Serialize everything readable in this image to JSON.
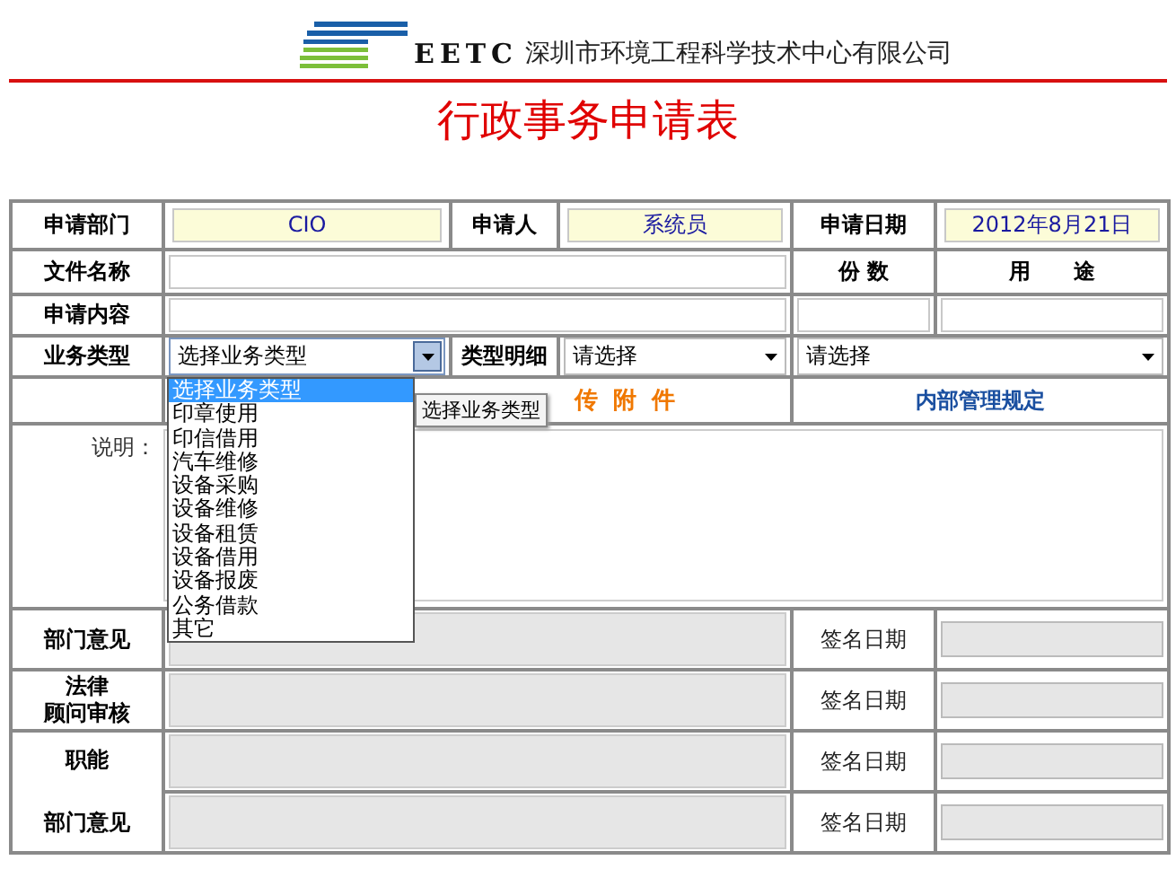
{
  "header": {
    "logo_text": "EETC",
    "company_name": "深圳市环境工程科学技术中心有限公司",
    "title": "行政事务申请表"
  },
  "form": {
    "department": {
      "label": "申请部门",
      "value": "CIO"
    },
    "applicant": {
      "label": "申请人",
      "value": "系统员"
    },
    "date": {
      "label": "申请日期",
      "value": "2012年8月21日"
    },
    "file_name": {
      "label": "文件名称"
    },
    "copies_label": "份 数",
    "purpose_label": "用　　途",
    "content": {
      "label": "申请内容"
    },
    "business_type": {
      "label": "业务类型",
      "value": "选择业务类型",
      "expanded": true,
      "tooltip": "选择业务类型",
      "options": [
        {
          "label": "选择业务类型",
          "selected": true
        },
        {
          "label": "印章使用",
          "selected": false
        },
        {
          "label": "印信借用",
          "selected": false
        },
        {
          "label": "汽车维修",
          "selected": false
        },
        {
          "label": "设备采购",
          "selected": false
        },
        {
          "label": "设备维修",
          "selected": false
        },
        {
          "label": "设备租赁",
          "selected": false
        },
        {
          "label": "设备借用",
          "selected": false
        },
        {
          "label": "设备报废",
          "selected": false
        },
        {
          "label": "公务借款",
          "selected": false
        },
        {
          "label": "其它",
          "selected": false
        }
      ]
    },
    "type_detail": {
      "label": "类型明细",
      "value": "请选择"
    },
    "sub_select": {
      "value": "请选择"
    },
    "attachment_link": "传 附 件",
    "rules_link": "内部管理规定",
    "note_label": "说明：",
    "approvals": [
      {
        "label_lines": [
          "部门意见"
        ],
        "rows": [
          {
            "sign_label": "签名日期"
          }
        ]
      },
      {
        "label_lines": [
          "法律",
          "顾问审核"
        ],
        "rows": [
          {
            "sign_label": "签名日期"
          }
        ]
      },
      {
        "label_lines": [
          "职能",
          "部门意见"
        ],
        "rows": [
          {
            "sign_label": "签名日期"
          },
          {
            "sign_label": "签名日期"
          }
        ]
      }
    ]
  }
}
